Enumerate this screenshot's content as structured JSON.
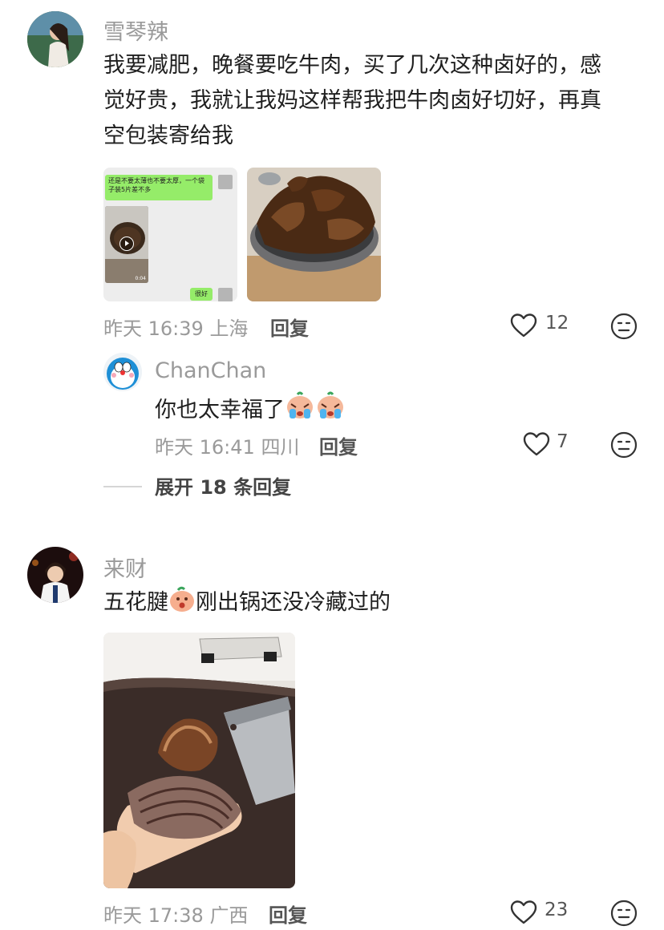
{
  "comments": [
    {
      "username": "雪琴辣",
      "text": "我要减肥，晚餐要吃牛肉，买了几次这种卤好的，感觉好贵，我就让我妈这样帮我把牛肉卤好切好，再真空包装寄给我",
      "lines": [
        "我要减肥，晚餐要吃牛肉，买了几次这种卤好的，感",
        "觉好贵，我就让我妈这样帮我把牛肉卤好切好，再真",
        "空包装寄给我"
      ],
      "time": "昨天 16:39",
      "location": "上海",
      "reply_label": "回复",
      "likes": "12",
      "chat_thumb": {
        "bubble1": "还是不要太薄也不要太厚，一个袋子装5片差不多",
        "video_time": "0:04",
        "bubble2": "很好"
      }
    },
    {
      "username": "来财",
      "text_before": "五花腱",
      "text_after": "刚出锅还没冷藏过的",
      "time": "昨天 17:38",
      "location": "广西",
      "reply_label": "回复",
      "likes": "23"
    }
  ],
  "reply": {
    "username": "ChanChan",
    "text": "你也太幸福了",
    "time": "昨天 16:41",
    "location": "四川",
    "reply_label": "回复",
    "likes": "7"
  },
  "expand_label": "展开 18 条回复",
  "icons": {
    "like": "heart-outline-icon",
    "dislike": "neutral-face-icon",
    "play": "play-icon"
  },
  "colors": {
    "chat_green": "#95ec69",
    "meta_gray": "#9a9a9a",
    "beef_brown": "#5a3318"
  }
}
